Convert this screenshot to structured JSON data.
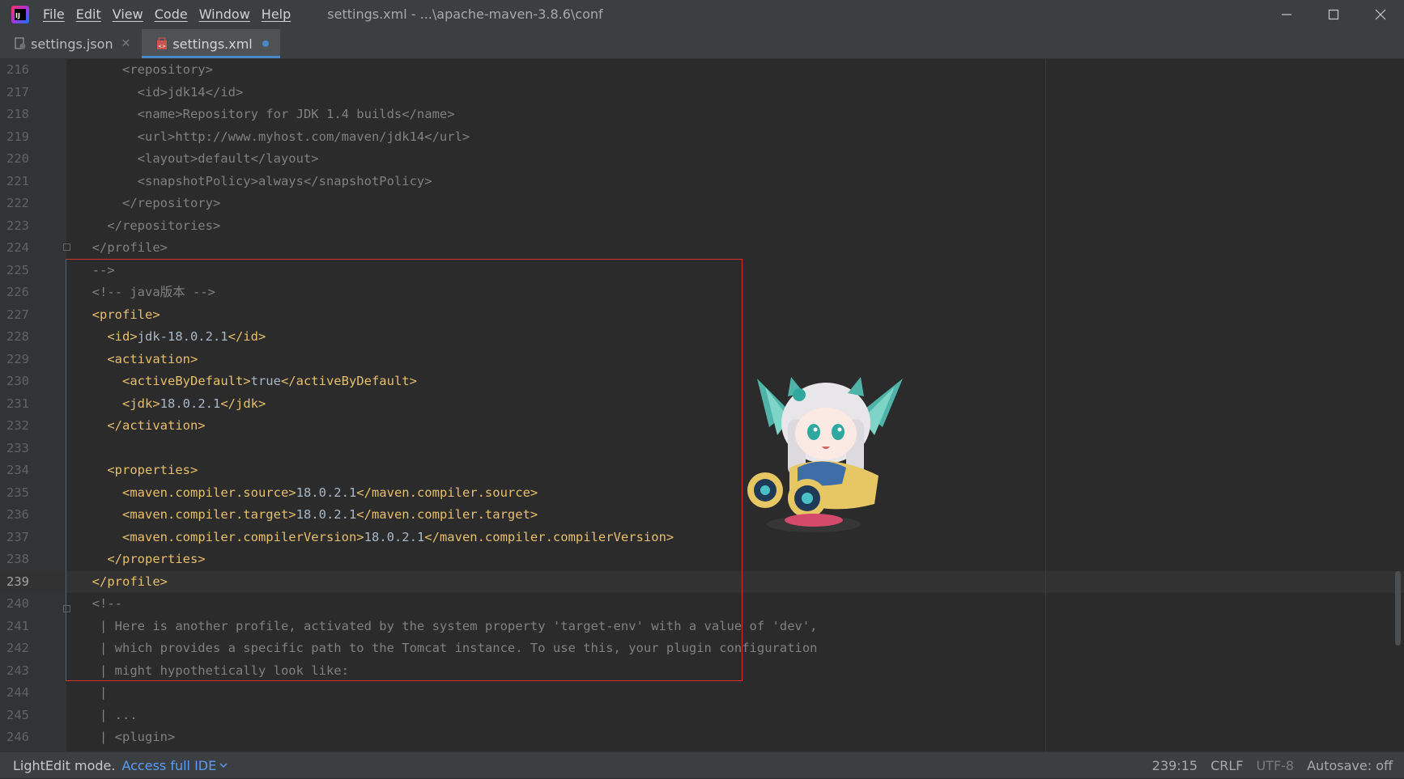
{
  "titlebar": {
    "menu": [
      "File",
      "Edit",
      "View",
      "Code",
      "Window",
      "Help"
    ],
    "window_title": "settings.xml - ...\\apache-maven-3.8.6\\conf"
  },
  "tabs": [
    {
      "label": "settings.json",
      "active": false
    },
    {
      "label": "settings.xml",
      "active": true
    }
  ],
  "editor": {
    "current_line": 239,
    "lines": [
      {
        "n": "216",
        "t": "      <repository>",
        "k": "comment"
      },
      {
        "n": "217",
        "t": "        <id>jdk14</id>",
        "k": "comment"
      },
      {
        "n": "218",
        "t": "        <name>Repository for JDK 1.4 builds</name>",
        "k": "comment"
      },
      {
        "n": "219",
        "t": "        <url>http://www.myhost.com/maven/jdk14</url>",
        "k": "comment"
      },
      {
        "n": "220",
        "t": "        <layout>default</layout>",
        "k": "comment"
      },
      {
        "n": "221",
        "t": "        <snapshotPolicy>always</snapshotPolicy>",
        "k": "comment"
      },
      {
        "n": "222",
        "t": "      </repository>",
        "k": "comment"
      },
      {
        "n": "223",
        "t": "    </repositories>",
        "k": "comment"
      },
      {
        "n": "224",
        "t": "  </profile>",
        "k": "comment"
      },
      {
        "n": "225",
        "t": "  -->",
        "k": "comment"
      },
      {
        "n": "226",
        "t": "  <!-- java版本 -->",
        "k": "comment"
      },
      {
        "n": "227",
        "t": "  <profile>",
        "k": "tag"
      },
      {
        "n": "228",
        "t": "    <id>jdk-18.0.2.1</id>",
        "k": "tag"
      },
      {
        "n": "229",
        "t": "    <activation>",
        "k": "tag"
      },
      {
        "n": "230",
        "t": "      <activeByDefault>true</activeByDefault>",
        "k": "tag"
      },
      {
        "n": "231",
        "t": "      <jdk>18.0.2.1</jdk>",
        "k": "tag"
      },
      {
        "n": "232",
        "t": "    </activation>",
        "k": "tag"
      },
      {
        "n": "233",
        "t": "",
        "k": "tag"
      },
      {
        "n": "234",
        "t": "    <properties>",
        "k": "tag"
      },
      {
        "n": "235",
        "t": "      <maven.compiler.source>18.0.2.1</maven.compiler.source>",
        "k": "tag"
      },
      {
        "n": "236",
        "t": "      <maven.compiler.target>18.0.2.1</maven.compiler.target>",
        "k": "tag"
      },
      {
        "n": "237",
        "t": "      <maven.compiler.compilerVersion>18.0.2.1</maven.compiler.compilerVersion>",
        "k": "tag"
      },
      {
        "n": "238",
        "t": "    </properties>",
        "k": "tag"
      },
      {
        "n": "239",
        "t": "  </profile>",
        "k": "tag"
      },
      {
        "n": "240",
        "t": "  <!--",
        "k": "comment"
      },
      {
        "n": "241",
        "t": "   | Here is another profile, activated by the system property 'target-env' with a value of 'dev',",
        "k": "comment"
      },
      {
        "n": "242",
        "t": "   | which provides a specific path to the Tomcat instance. To use this, your plugin configuration",
        "k": "comment"
      },
      {
        "n": "243",
        "t": "   | might hypothetically look like:",
        "k": "comment"
      },
      {
        "n": "244",
        "t": "   |",
        "k": "comment"
      },
      {
        "n": "245",
        "t": "   | ...",
        "k": "comment"
      },
      {
        "n": "246",
        "t": "   | <plugin>",
        "k": "comment"
      }
    ]
  },
  "statusbar": {
    "mode": "LightEdit mode.",
    "access_link": "Access full IDE",
    "position": "239:15",
    "line_separator": "CRLF",
    "encoding": "UTF-8",
    "autosave": "Autosave: off"
  },
  "colors": {
    "background": "#2b2b2b",
    "tag": "#e8bf6a",
    "text": "#a9b7c6",
    "comment": "#808080",
    "highlight_box": "#d62f2f",
    "accent": "#4a88c7"
  }
}
